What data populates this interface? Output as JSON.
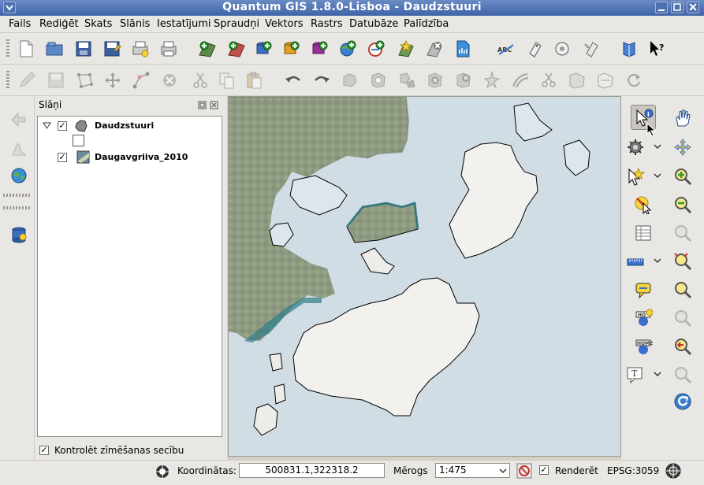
{
  "window": {
    "title": "Quantum GIS 1.8.0-Lisboa - Daudzstuuri"
  },
  "menu": {
    "items": [
      "Fails",
      "Rediģēt",
      "Skats",
      "Slānis",
      "Iestatījumi",
      "Spraudņi",
      "Vektors",
      "Rastrs",
      "Datubāze",
      "Palīdzība"
    ]
  },
  "layers_panel": {
    "title": "Slāņi",
    "layers": [
      {
        "name": "Daudzstuuri",
        "checked": true,
        "expanded": true
      },
      {
        "name": "Daugavgriiva_2010",
        "checked": true
      }
    ],
    "render_order_label": "Kontrolēt zīmēšanas secību",
    "render_order_checked": true
  },
  "statusbar": {
    "coordinates_label": "Koordinātas:",
    "coordinates_value": "500831.1,322318.2",
    "scale_label": "Mērogs",
    "scale_value": "1:475",
    "render_label": "Renderēt",
    "render_checked": true,
    "crs": "EPSG:3059"
  },
  "colors": {
    "title_bar": "#3f64a8",
    "water": "#d1dde5",
    "land": "#8e9a7f",
    "island": "#f2f1ee"
  },
  "icons": {
    "toolbar1": [
      "new-project-icon",
      "open-project-icon",
      "save-icon",
      "save-as-icon",
      "new-print-composer-icon",
      "print-icon",
      "add-raster-icon",
      "add-vector-icon",
      "add-postgis-icon",
      "add-spatialite-icon",
      "add-mssql-icon",
      "add-wms-icon",
      "add-wfs-icon",
      "new-shapefile-icon",
      "remove-layer-icon",
      "new-spatialite-icon",
      "spell-check-icon",
      "label-icon",
      "pin-icon",
      "plugins-icon",
      "guide-icon",
      "whats-this-icon"
    ],
    "toolbar2": [
      "edit-pencil-icon",
      "save-edits-icon",
      "add-feature-icon",
      "move-feature-icon",
      "node-tool-icon",
      "delete-selected-icon",
      "cut-icon",
      "copy-icon",
      "paste-icon",
      "undo-icon",
      "redo-icon",
      "simplify-icon",
      "add-ring-icon",
      "add-part-icon",
      "delete-ring-icon",
      "delete-part-icon",
      "reshape-icon",
      "offset-curve-icon",
      "split-features-icon",
      "merge-features-icon",
      "merge-attributes-icon",
      "rotate-point-icon"
    ],
    "leftstrip": [
      "digitize-icon",
      "histogram-icon",
      "globe-icon",
      "database-icon"
    ],
    "right_col1": [
      "identify-icon",
      "settings-gear-icon",
      "select-icon",
      "deselect-icon",
      "attribute-table-icon",
      "measure-icon",
      "map-tips-icon",
      "new-bookmark-icon",
      "show-bookmarks-icon",
      "text-annotation-icon"
    ],
    "right_col2": [
      "pan-hand-icon",
      "pan-to-selection-icon",
      "zoom-in-icon",
      "zoom-out-icon",
      "zoom-native-icon",
      "zoom-full-icon",
      "zoom-layer-icon",
      "zoom-selection-icon",
      "zoom-last-icon",
      "zoom-next-icon",
      "refresh-icon"
    ]
  }
}
